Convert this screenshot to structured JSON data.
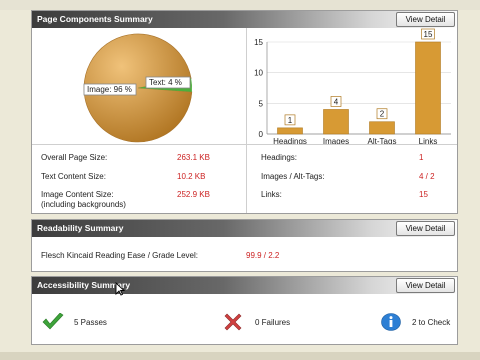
{
  "page_components": {
    "title": "Page Components Summary",
    "view_detail": "View Detail",
    "pie": {
      "slices": [
        {
          "label": "Image: 96 %",
          "value": 96,
          "color": "#c89034"
        },
        {
          "label": "Text: 4 %",
          "value": 4,
          "color": "#4caf3c"
        }
      ]
    },
    "stats_left": [
      {
        "label": "Overall Page Size:",
        "value": "263.1 KB"
      },
      {
        "label": "Text Content Size:",
        "value": "10.2 KB"
      },
      {
        "label": "Image Content Size:",
        "sublabel": "(including backgrounds)",
        "value": "252.9 KB"
      }
    ],
    "stats_right": [
      {
        "label": "Headings:",
        "value": "1"
      },
      {
        "label": "Images / Alt-Tags:",
        "value": "4 / 2"
      },
      {
        "label": "Links:",
        "value": "15"
      }
    ]
  },
  "chart_data": {
    "type": "bar",
    "categories": [
      "Headings",
      "Images",
      "Alt-Tags",
      "Links"
    ],
    "values": [
      1,
      4,
      2,
      15
    ],
    "ylim": [
      0,
      15
    ],
    "yticks": [
      "0",
      "5",
      "10",
      "15"
    ],
    "grid": true,
    "bar_color": "#d79a34"
  },
  "readability": {
    "title": "Readability Summary",
    "view_detail": "View Detail",
    "label": "Flesch Kincaid Reading Ease / Grade Level:",
    "value": "99.9 / 2.2"
  },
  "accessibility": {
    "title": "Accessibility Summary",
    "view_detail": "View Detail",
    "items": [
      {
        "icon": "check-icon",
        "label": "5 Passes"
      },
      {
        "icon": "x-icon",
        "label": "0 Failures"
      },
      {
        "icon": "info-icon",
        "label": "2 to Check"
      }
    ]
  },
  "colors": {
    "value_red": "#cc2222",
    "check_green": "#3da33a",
    "fail_red": "#d04040",
    "info_blue": "#2d7fd4"
  }
}
